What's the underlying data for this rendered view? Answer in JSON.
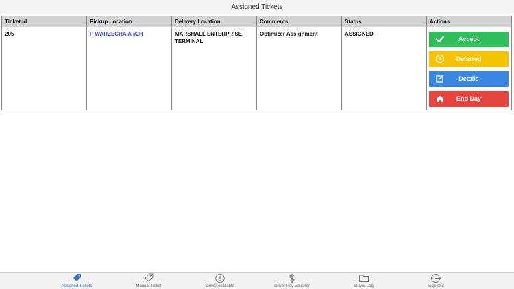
{
  "window": {
    "title": "Assigned Tickets"
  },
  "table": {
    "headers": [
      "Ticket Id",
      "Pickup Location",
      "Delivery Location",
      "Comments",
      "Status",
      "Actions"
    ],
    "row": {
      "ticket_id": "205",
      "pickup": "P WARZECHA A #2H",
      "delivery": "MARSHALL ENTERPRISE TERMINAL",
      "comments": "Optimizer Assignment",
      "status": "ASSIGNED"
    }
  },
  "actions": {
    "accept": "Accept",
    "deferred": "Deferred",
    "details": "Details",
    "end_day": "End Day"
  },
  "colors": {
    "accept": "#2fbe5a",
    "deferred": "#f6c300",
    "details": "#3a86e0",
    "end_day": "#e5463f",
    "link": "#3a47d0",
    "active_tab": "#3a6fc6"
  },
  "bottom_nav": {
    "assigned": {
      "label": "Assigned Tickets",
      "icon": "tag-filled-icon"
    },
    "manual": {
      "label": "Manual Ticket",
      "icon": "tag-outline-icon"
    },
    "available": {
      "label": "Driver Available",
      "icon": "exclamation-circle-icon"
    },
    "pay": {
      "label": "Driver Pay Voucher",
      "icon": "dollar-icon"
    },
    "log": {
      "label": "Driver Log",
      "icon": "folder-icon"
    },
    "signout": {
      "label": "Sign-Out",
      "icon": "signout-icon"
    }
  }
}
